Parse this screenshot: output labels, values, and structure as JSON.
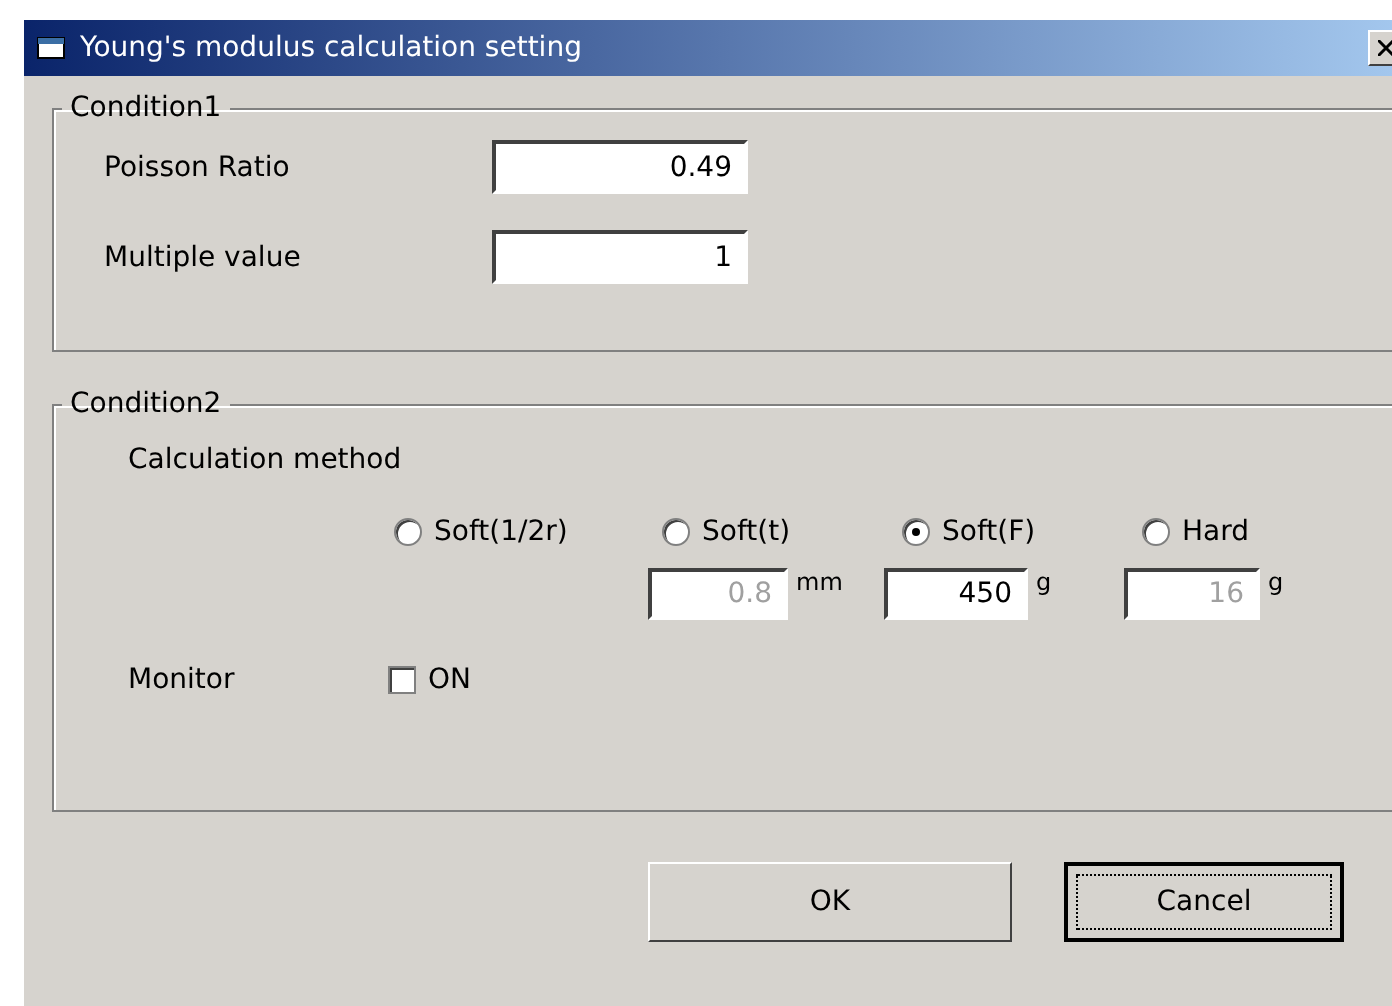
{
  "window": {
    "title": "Young's modulus calculation setting"
  },
  "condition1": {
    "legend": "Condition1",
    "fields": [
      {
        "label": "Poisson Ratio",
        "value": "0.49"
      },
      {
        "label": "Multiple value",
        "value": "1"
      }
    ]
  },
  "condition2": {
    "legend": "Condition2",
    "method_label": "Calculation method",
    "radios": [
      {
        "label": "Soft(1/2r)",
        "selected": false
      },
      {
        "label": "Soft(t)",
        "selected": false
      },
      {
        "label": "Soft(F)",
        "selected": true
      },
      {
        "label": "Hard",
        "selected": false
      }
    ],
    "inputs": [
      {
        "value": "0.8",
        "unit": "mm",
        "disabled": true
      },
      {
        "value": "450",
        "unit": "g",
        "disabled": false
      },
      {
        "value": "16",
        "unit": "g",
        "disabled": true
      }
    ],
    "monitor": {
      "label": "Monitor",
      "checkbox_label": "ON",
      "checked": false
    }
  },
  "buttons": [
    {
      "label": "OK",
      "default": false
    },
    {
      "label": "Cancel",
      "default": true
    }
  ]
}
